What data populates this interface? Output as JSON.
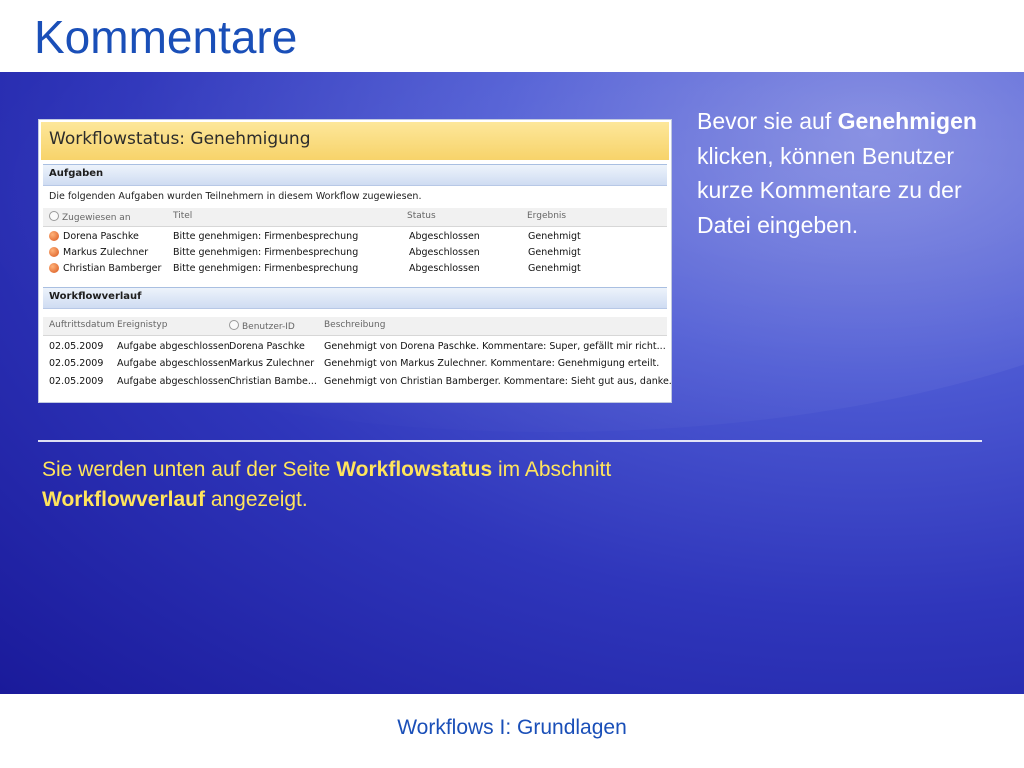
{
  "slide": {
    "title": "Kommentare",
    "side_text": {
      "t1": "Bevor sie auf ",
      "b1": "Genehmigen",
      "t2": " klicken, können Benutzer kurze Kommentare zu der Datei eingeben."
    },
    "note": {
      "t1": "Sie werden unten auf der Seite ",
      "b1": "Workflowstatus",
      "t2": " im Abschnitt ",
      "b2": "Workflowverlauf",
      "t3": " angezeigt."
    },
    "footer": "Workflows I: Grundlagen"
  },
  "screenshot": {
    "header": "Workflowstatus: Genehmigung",
    "tasks": {
      "title": "Aufgaben",
      "description": "Die folgenden Aufgaben wurden Teilnehmern in diesem Workflow zugewiesen.",
      "columns": [
        "Zugewiesen an",
        "Titel",
        "Status",
        "Ergebnis"
      ],
      "rows": [
        {
          "assigned": "Dorena Paschke",
          "title": "Bitte genehmigen: Firmenbesprechung",
          "status": "Abgeschlossen",
          "result": "Genehmigt"
        },
        {
          "assigned": "Markus Zulechner",
          "title": "Bitte genehmigen: Firmenbesprechung",
          "status": "Abgeschlossen",
          "result": "Genehmigt"
        },
        {
          "assigned": "Christian Bamberger",
          "title": "Bitte genehmigen: Firmenbesprechung",
          "status": "Abgeschlossen",
          "result": "Genehmigt"
        }
      ]
    },
    "history": {
      "title": "Workflowverlauf",
      "columns": [
        "Auftrittsdatum",
        "Ereignistyp",
        "Benutzer-ID",
        "Beschreibung"
      ],
      "rows": [
        {
          "date": "02.05.2009",
          "event": "Aufgabe abgeschlossen",
          "user": "Dorena Paschke",
          "description": "Genehmigt von Dorena Paschke. Kommentare: Super, gefällt mir richt..."
        },
        {
          "date": "02.05.2009",
          "event": "Aufgabe abgeschlossen",
          "user": "Markus Zulechner",
          "description": "Genehmigt von Markus Zulechner. Kommentare: Genehmigung erteilt."
        },
        {
          "date": "02.05.2009",
          "event": "Aufgabe abgeschlossen",
          "user": "Christian Bambe...",
          "description": "Genehmigt von Christian Bamberger. Kommentare: Sieht gut aus, danke."
        }
      ]
    }
  },
  "colors": {
    "title": "#1a4fb8",
    "note": "#ffe45c",
    "background_blue": "#2f36bb",
    "header_yellow": "#f7d36a",
    "status_dot": "#d8561c"
  }
}
